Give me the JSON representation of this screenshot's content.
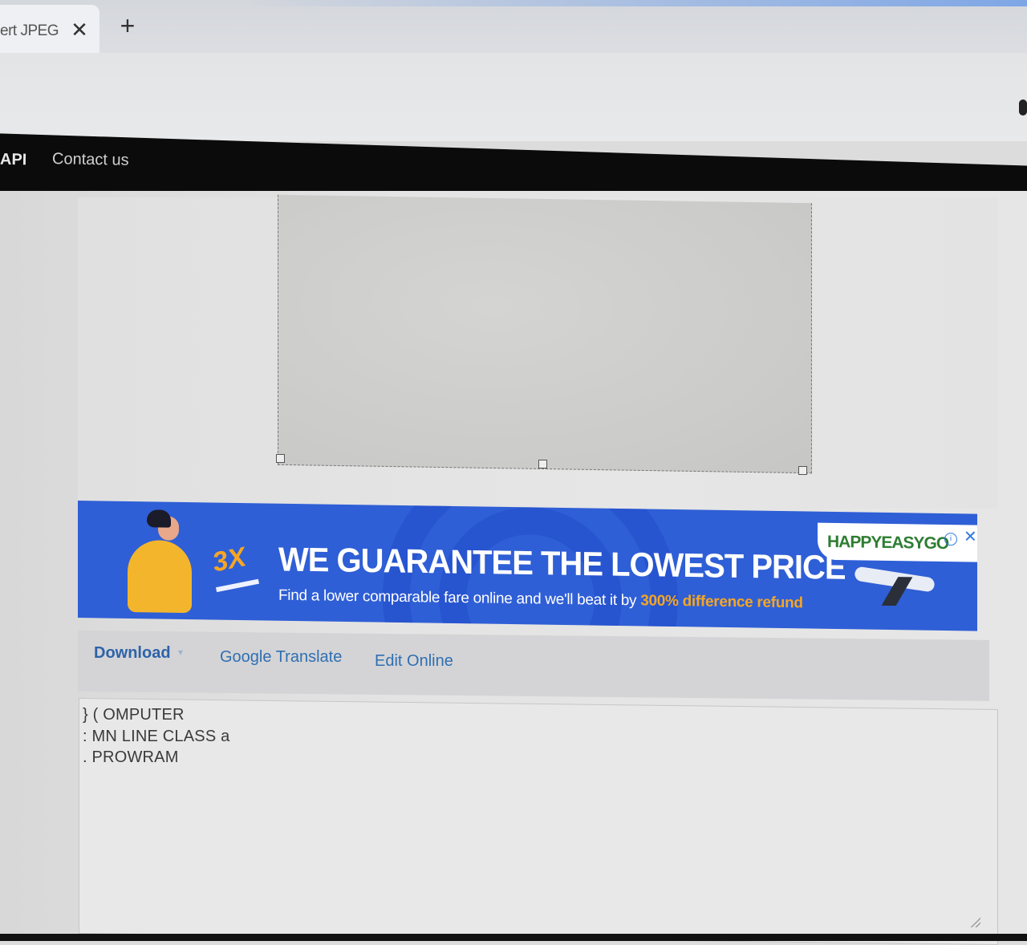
{
  "browser": {
    "tab_title": "ert JPEG",
    "tab_close": "✕",
    "new_tab": "+"
  },
  "nav": {
    "api": "API",
    "contact": "Contact us"
  },
  "ad": {
    "badge": "3X",
    "headline": "WE GUARANTEE THE LOWEST PRICE",
    "subline": "Find a lower comparable fare online and we'll beat it by",
    "highlight": "300% difference refund",
    "logo": "HAPPYEASYGO",
    "info": "i",
    "close": "✕",
    "colors": {
      "background": "#2f5fd6",
      "accent": "#f5a623",
      "logo": "#2e7d32"
    }
  },
  "actions": {
    "download": "Download",
    "download_caret": "▾",
    "translate": "Google Translate",
    "edit": "Edit Online"
  },
  "output": {
    "lines": [
      "} ( OMPUTER",
      ": MN LINE CLASS a",
      ". PROWRAM"
    ]
  }
}
